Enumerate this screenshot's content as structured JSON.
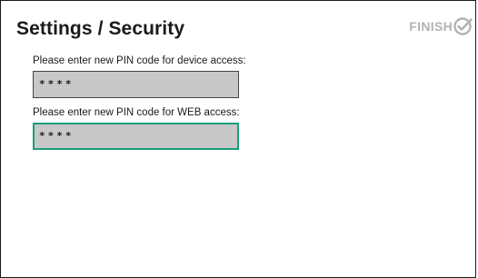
{
  "header": {
    "title": "Settings / Security",
    "finish_label": "FINISH",
    "finish_icon": "check-circle-icon"
  },
  "form": {
    "device_pin": {
      "label": "Please enter new PIN code for device access:",
      "value": "****"
    },
    "web_pin": {
      "label": "Please enter new PIN code for WEB access:",
      "value": "****"
    }
  },
  "colors": {
    "focus_border": "#1a9e7a",
    "input_background": "#c8c8c8",
    "finish_disabled": "#b3b3b3"
  }
}
